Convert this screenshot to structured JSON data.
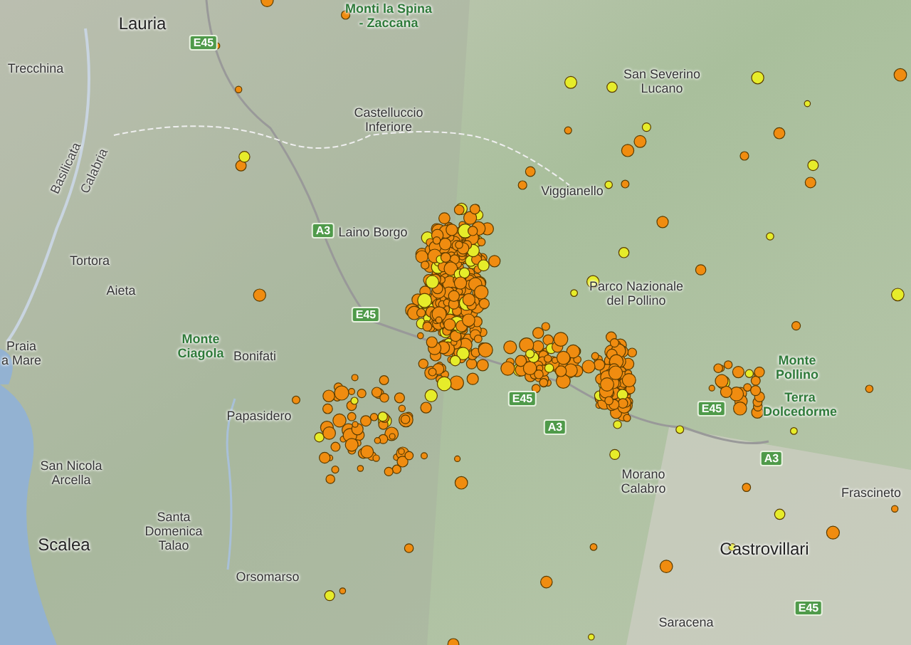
{
  "map": {
    "labels": [
      {
        "kind": "city",
        "lines": [
          "Lauria"
        ]
      },
      {
        "kind": "park",
        "lines": [
          "Monti la Spina",
          "- Zaccana"
        ]
      },
      {
        "kind": "town",
        "lines": [
          "Trecchina"
        ]
      },
      {
        "kind": "town",
        "lines": [
          "Castelluccio",
          "Inferiore"
        ]
      },
      {
        "kind": "town",
        "lines": [
          "San Severino",
          "Lucano"
        ]
      },
      {
        "kind": "town",
        "lines": [
          "Viggianello"
        ]
      },
      {
        "kind": "region",
        "lines": [
          "Basilicata"
        ]
      },
      {
        "kind": "region",
        "lines": [
          "Calabria"
        ]
      },
      {
        "kind": "town",
        "lines": [
          "Tortora"
        ]
      },
      {
        "kind": "town",
        "lines": [
          "Aieta"
        ]
      },
      {
        "kind": "town",
        "lines": [
          "Laino Borgo"
        ]
      },
      {
        "kind": "town",
        "lines": [
          "Parco Nazionale",
          "del Pollino"
        ]
      },
      {
        "kind": "town",
        "lines": [
          "Praia",
          "a Mare"
        ]
      },
      {
        "kind": "park",
        "lines": [
          "Monte",
          "Ciagola"
        ]
      },
      {
        "kind": "town",
        "lines": [
          "Bonifati"
        ]
      },
      {
        "kind": "town",
        "lines": [
          "Papasidero"
        ]
      },
      {
        "kind": "town",
        "lines": [
          "San Nicola",
          "Arcella"
        ]
      },
      {
        "kind": "city",
        "lines": [
          "Scalea"
        ]
      },
      {
        "kind": "town",
        "lines": [
          "Santa",
          "Domenica",
          "Talao"
        ]
      },
      {
        "kind": "town",
        "lines": [
          "Orsomarso"
        ]
      },
      {
        "kind": "town",
        "lines": [
          "Morano",
          "Calabro"
        ]
      },
      {
        "kind": "park",
        "lines": [
          "Monte",
          "Pollino"
        ]
      },
      {
        "kind": "park",
        "lines": [
          "Terra",
          "Dolcedorme"
        ]
      },
      {
        "kind": "town",
        "lines": [
          "Frascineto"
        ]
      },
      {
        "kind": "city",
        "lines": [
          "Castrovillari"
        ]
      },
      {
        "kind": "town",
        "lines": [
          "Saracena"
        ]
      }
    ],
    "road_shields": [
      "E45",
      "A3",
      "E45",
      "E45",
      "A3",
      "E45",
      "A3",
      "E45"
    ]
  }
}
